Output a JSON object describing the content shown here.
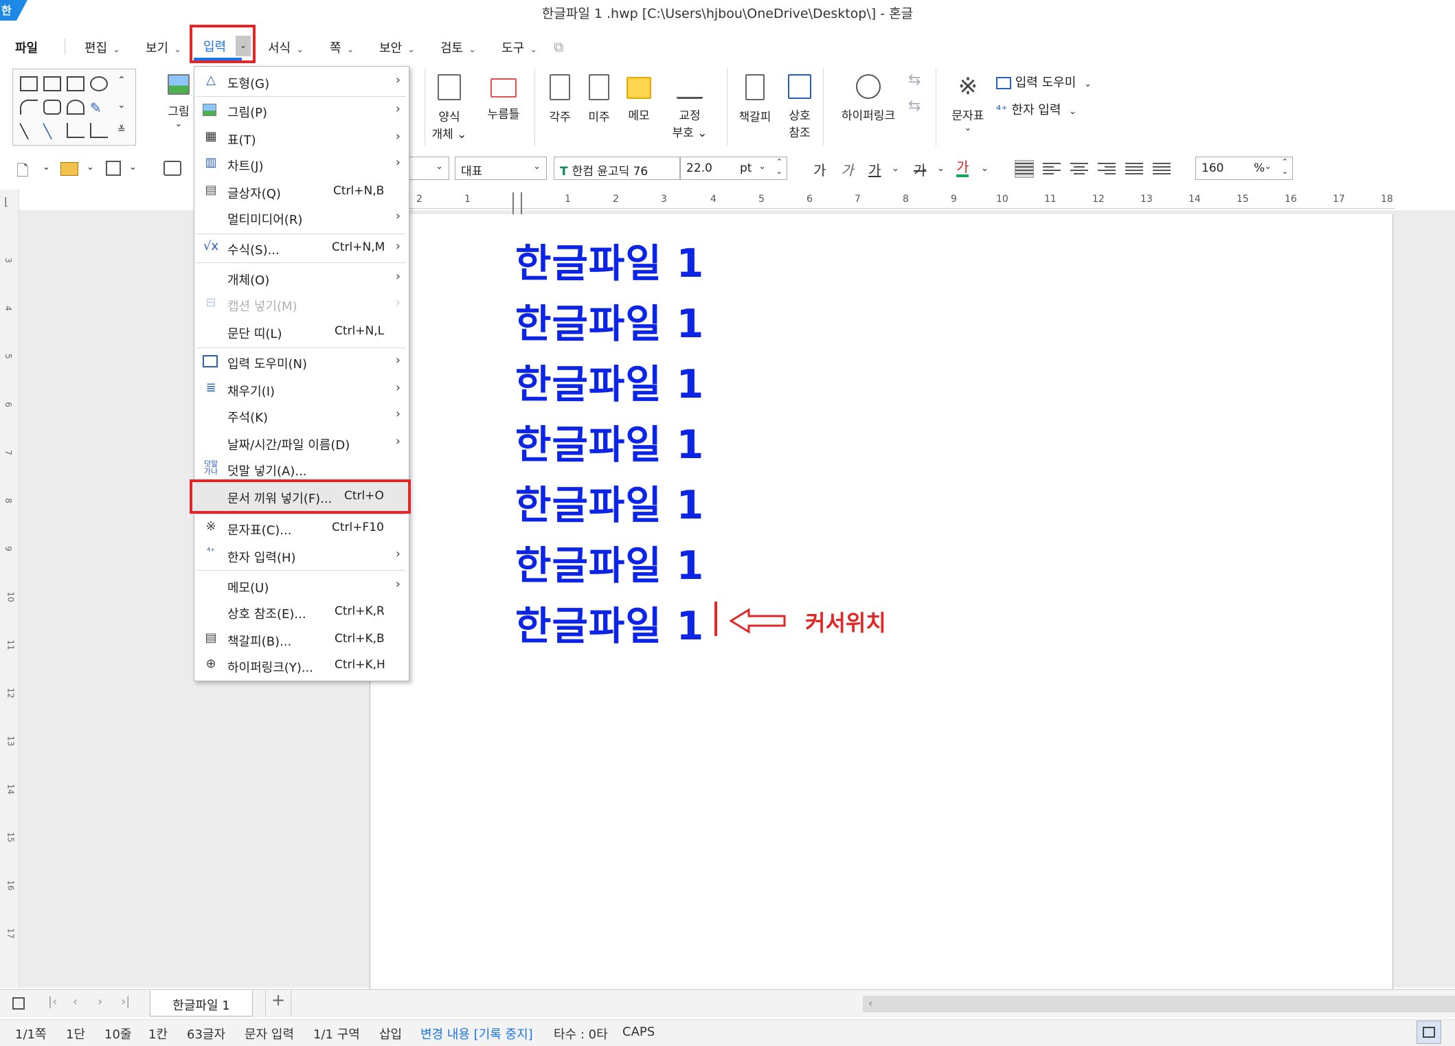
{
  "window": {
    "title": "한글파일 1 .hwp [C:\\Users\\hjbou\\OneDrive\\Desktop\\] - 혼글",
    "logo": "한"
  },
  "menubar": {
    "file": "파일",
    "items": [
      "편집",
      "보기",
      "입력",
      "서식",
      "쪽",
      "보안",
      "검토",
      "도구"
    ],
    "active": "입력"
  },
  "ribbon": {
    "picture": "그림",
    "form_object": [
      "양식",
      "개체"
    ],
    "stamp": "누름틀",
    "footnote": "각주",
    "endnote": "미주",
    "memo": "메모",
    "proof": [
      "교정",
      "부호"
    ],
    "bookmark": "책갈피",
    "crossref": [
      "상호",
      "참조"
    ],
    "hyperlink": "하이퍼링크",
    "charmap": "문자표",
    "input_helper": "입력 도우미",
    "hanja_input": "한자 입력"
  },
  "toolbar2": {
    "style": "대표",
    "font": "한컴 윤고딕 76",
    "font_size": "22.0",
    "size_unit": "pt",
    "zoom": "160",
    "zoom_unit": "%",
    "format_buttons": [
      "가",
      "가",
      "가",
      "가",
      "가"
    ]
  },
  "ruler": {
    "top_numbers": [
      "2",
      "1",
      "1",
      "2",
      "3",
      "4",
      "5",
      "6",
      "7",
      "8",
      "9",
      "10",
      "11",
      "12",
      "13",
      "14",
      "15",
      "16",
      "17",
      "18"
    ],
    "left_numbers": [
      "3",
      "4",
      "5",
      "6",
      "7",
      "8",
      "9",
      "10",
      "11",
      "12",
      "13",
      "14",
      "15",
      "16",
      "17"
    ]
  },
  "dropdown": {
    "items": [
      {
        "icon": "shape-icon",
        "label": "도형(G)",
        "shortcut": "",
        "submenu": true
      },
      {
        "icon": "picture-icon",
        "label": "그림(P)",
        "shortcut": "",
        "submenu": true
      },
      {
        "icon": "table-icon",
        "label": "표(T)",
        "shortcut": "",
        "submenu": true
      },
      {
        "icon": "chart-icon",
        "label": "차트(J)",
        "shortcut": "",
        "submenu": true
      },
      {
        "icon": "textbox-icon",
        "label": "글상자(Q)",
        "shortcut": "Ctrl+N,B",
        "submenu": false
      },
      {
        "icon": "",
        "label": "멀티미디어(R)",
        "shortcut": "",
        "submenu": true
      },
      {
        "icon": "formula-icon",
        "label": "수식(S)...",
        "shortcut": "Ctrl+N,M",
        "submenu": true
      },
      {
        "icon": "",
        "label": "개체(O)",
        "shortcut": "",
        "submenu": true
      },
      {
        "icon": "caption-icon",
        "label": "캡션 넣기(M)",
        "shortcut": "",
        "submenu": true,
        "disabled": true
      },
      {
        "icon": "",
        "label": "문단 띠(L)",
        "shortcut": "Ctrl+N,L",
        "submenu": false
      },
      {
        "icon": "input-helper-icon",
        "label": "입력 도우미(N)",
        "shortcut": "",
        "submenu": true
      },
      {
        "icon": "fill-icon",
        "label": "채우기(I)",
        "shortcut": "",
        "submenu": true
      },
      {
        "icon": "",
        "label": "주석(K)",
        "shortcut": "",
        "submenu": true
      },
      {
        "icon": "",
        "label": "날짜/시간/파일 이름(D)",
        "shortcut": "",
        "submenu": true
      },
      {
        "icon": "ruby-icon",
        "label": "덧말 넣기(A)...",
        "shortcut": "",
        "submenu": false
      },
      {
        "icon": "",
        "label": "문서 끼워 넣기(F)...",
        "shortcut": "Ctrl+O",
        "submenu": false,
        "highlighted": true
      },
      {
        "icon": "charmap-icon",
        "label": "문자표(C)...",
        "shortcut": "Ctrl+F10",
        "submenu": false
      },
      {
        "icon": "hanja-icon",
        "label": "한자 입력(H)",
        "shortcut": "",
        "submenu": true
      },
      {
        "icon": "",
        "label": "메모(U)",
        "shortcut": "",
        "submenu": true
      },
      {
        "icon": "",
        "label": "상호 참조(E)...",
        "shortcut": "Ctrl+K,R",
        "submenu": false
      },
      {
        "icon": "bookmark-icon",
        "label": "책갈피(B)...",
        "shortcut": "Ctrl+K,B",
        "submenu": false
      },
      {
        "icon": "hyperlink-icon",
        "label": "하이퍼링크(Y)...",
        "shortcut": "Ctrl+K,H",
        "submenu": false
      }
    ]
  },
  "document": {
    "lines": [
      "한글파일 1",
      "한글파일 1",
      "한글파일 1",
      "한글파일 1",
      "한글파일 1",
      "한글파일 1",
      "한글파일 1"
    ],
    "annotation": "커서위치"
  },
  "tabs": {
    "doc_tab": "한글파일 1",
    "add": "+"
  },
  "statusbar": {
    "page": "1/1쪽",
    "column": "1단",
    "line": "10줄",
    "col_pos": "1칸",
    "chars": "63글자",
    "mode": "문자 입력",
    "section": "1/1 구역",
    "insert": "삽입",
    "track": "변경 내용 [기록 중지]",
    "typing": "타수 : 0타",
    "caps": "CAPS"
  },
  "colors": {
    "accent": "#1a73e8",
    "highlight_box": "#e02828",
    "doc_text": "#0b24e6"
  }
}
